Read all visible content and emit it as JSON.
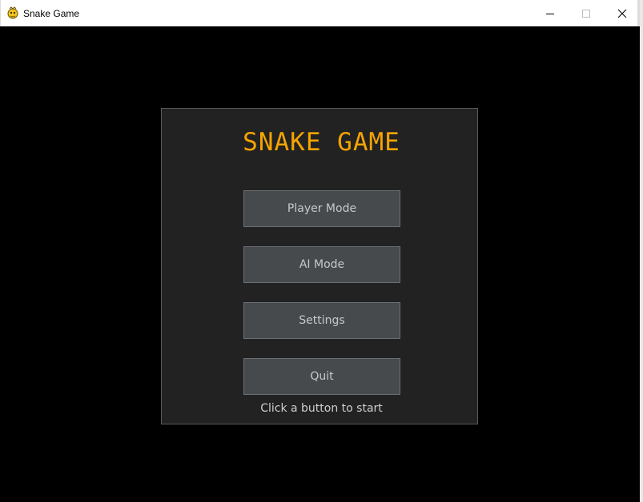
{
  "window": {
    "title": "Snake Game",
    "icon": "pygame-snake-icon"
  },
  "menu": {
    "title": "SNAKE GAME",
    "buttons": [
      {
        "label": "Player Mode"
      },
      {
        "label": "AI Mode"
      },
      {
        "label": "Settings"
      },
      {
        "label": "Quit"
      }
    ],
    "hint": "Click a button to start"
  },
  "colors": {
    "title": "#f5a400",
    "panel": "#222222",
    "button": "#464a4d",
    "background": "#000000"
  }
}
